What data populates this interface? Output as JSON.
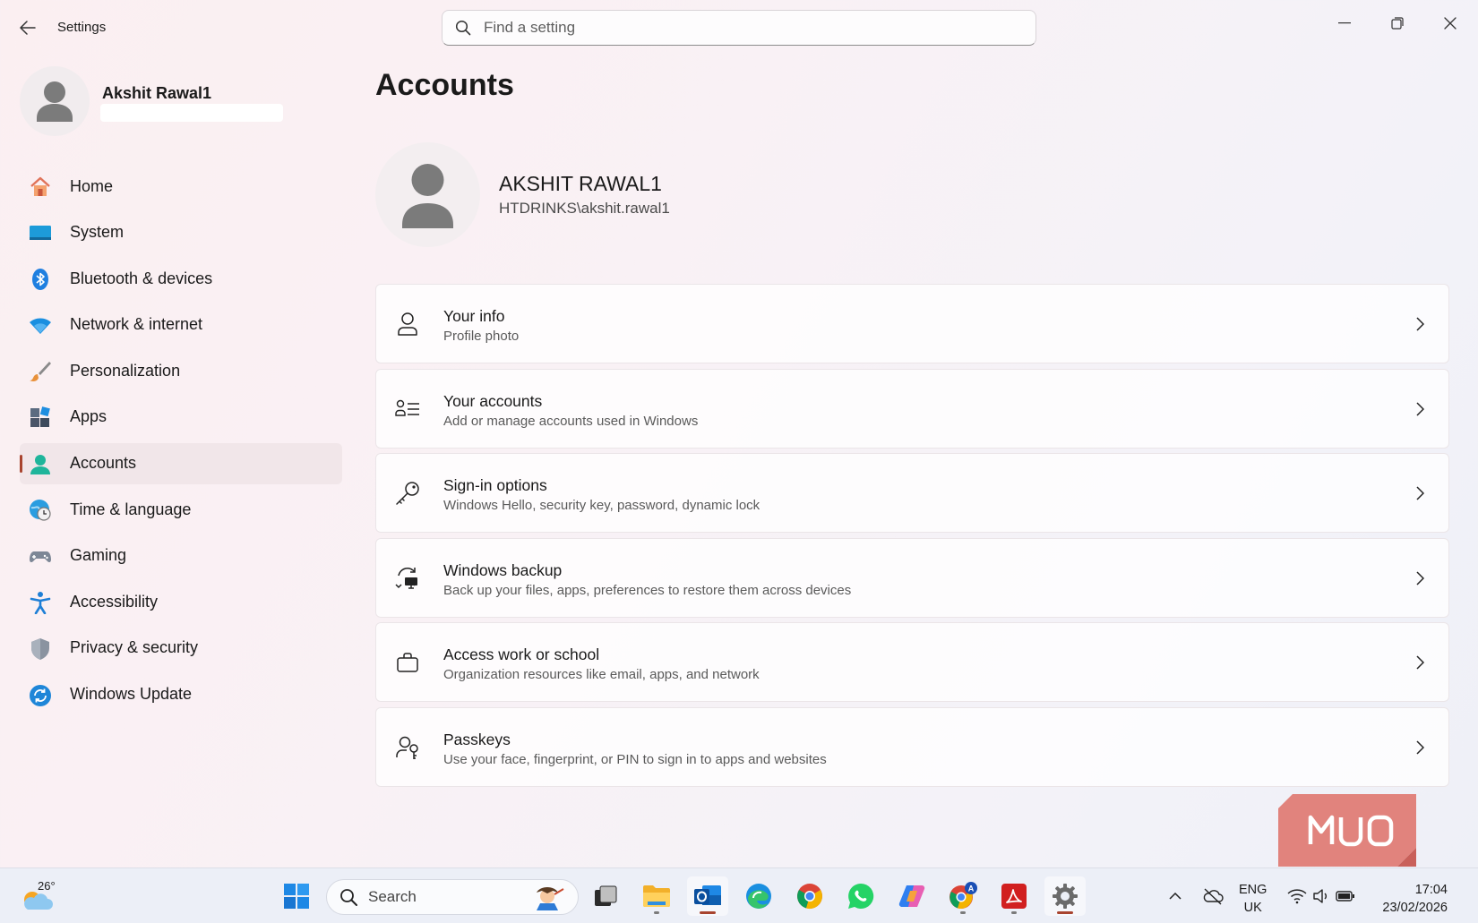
{
  "window": {
    "title": "Settings",
    "search_placeholder": "Find a setting"
  },
  "profile": {
    "name": "Akshit Rawal1"
  },
  "sidebar": {
    "items": [
      {
        "label": "Home",
        "icon": "home-icon"
      },
      {
        "label": "System",
        "icon": "system-icon"
      },
      {
        "label": "Bluetooth & devices",
        "icon": "bluetooth-icon"
      },
      {
        "label": "Network & internet",
        "icon": "wifi-icon"
      },
      {
        "label": "Personalization",
        "icon": "brush-icon"
      },
      {
        "label": "Apps",
        "icon": "apps-icon"
      },
      {
        "label": "Accounts",
        "icon": "accounts-icon",
        "active": true
      },
      {
        "label": "Time & language",
        "icon": "globe-clock-icon"
      },
      {
        "label": "Gaming",
        "icon": "gamepad-icon"
      },
      {
        "label": "Accessibility",
        "icon": "accessibility-icon"
      },
      {
        "label": "Privacy & security",
        "icon": "shield-icon"
      },
      {
        "label": "Windows Update",
        "icon": "update-icon"
      }
    ]
  },
  "main": {
    "title": "Accounts",
    "account_name": "AKSHIT RAWAL1",
    "account_domain": "HTDRINKS\\akshit.rawal1",
    "cards": [
      {
        "title": "Your info",
        "subtitle": "Profile photo",
        "icon": "person-icon"
      },
      {
        "title": "Your accounts",
        "subtitle": "Add or manage accounts used in Windows",
        "icon": "person-list-icon"
      },
      {
        "title": "Sign-in options",
        "subtitle": "Windows Hello, security key, password, dynamic lock",
        "icon": "key-icon"
      },
      {
        "title": "Windows backup",
        "subtitle": "Back up your files, apps, preferences to restore them across devices",
        "icon": "backup-icon"
      },
      {
        "title": "Access work or school",
        "subtitle": "Organization resources like email, apps, and network",
        "icon": "briefcase-icon"
      },
      {
        "title": "Passkeys",
        "subtitle": "Use your face, fingerprint, or PIN to sign in to apps and websites",
        "icon": "passkey-icon"
      }
    ]
  },
  "watermark": {
    "text": "MUO",
    "color": "#e07a72"
  },
  "taskbar": {
    "weather_temp": "26°",
    "search_label": "Search",
    "apps": [
      {
        "name": "start-button"
      },
      {
        "name": "task-view"
      },
      {
        "name": "file-explorer"
      },
      {
        "name": "outlook",
        "active": true
      },
      {
        "name": "edge"
      },
      {
        "name": "chrome"
      },
      {
        "name": "whatsapp"
      },
      {
        "name": "copilot"
      },
      {
        "name": "chrome-profile"
      },
      {
        "name": "acrobat"
      },
      {
        "name": "settings",
        "active": true
      }
    ],
    "lang_line1": "ENG",
    "lang_line2": "UK",
    "time": "17:04",
    "date": "23/02/2026"
  },
  "colors": {
    "accent": "#a8442f",
    "active_nav_bg": "#f1e6e9",
    "taskbar_bg": "#eceff7"
  }
}
